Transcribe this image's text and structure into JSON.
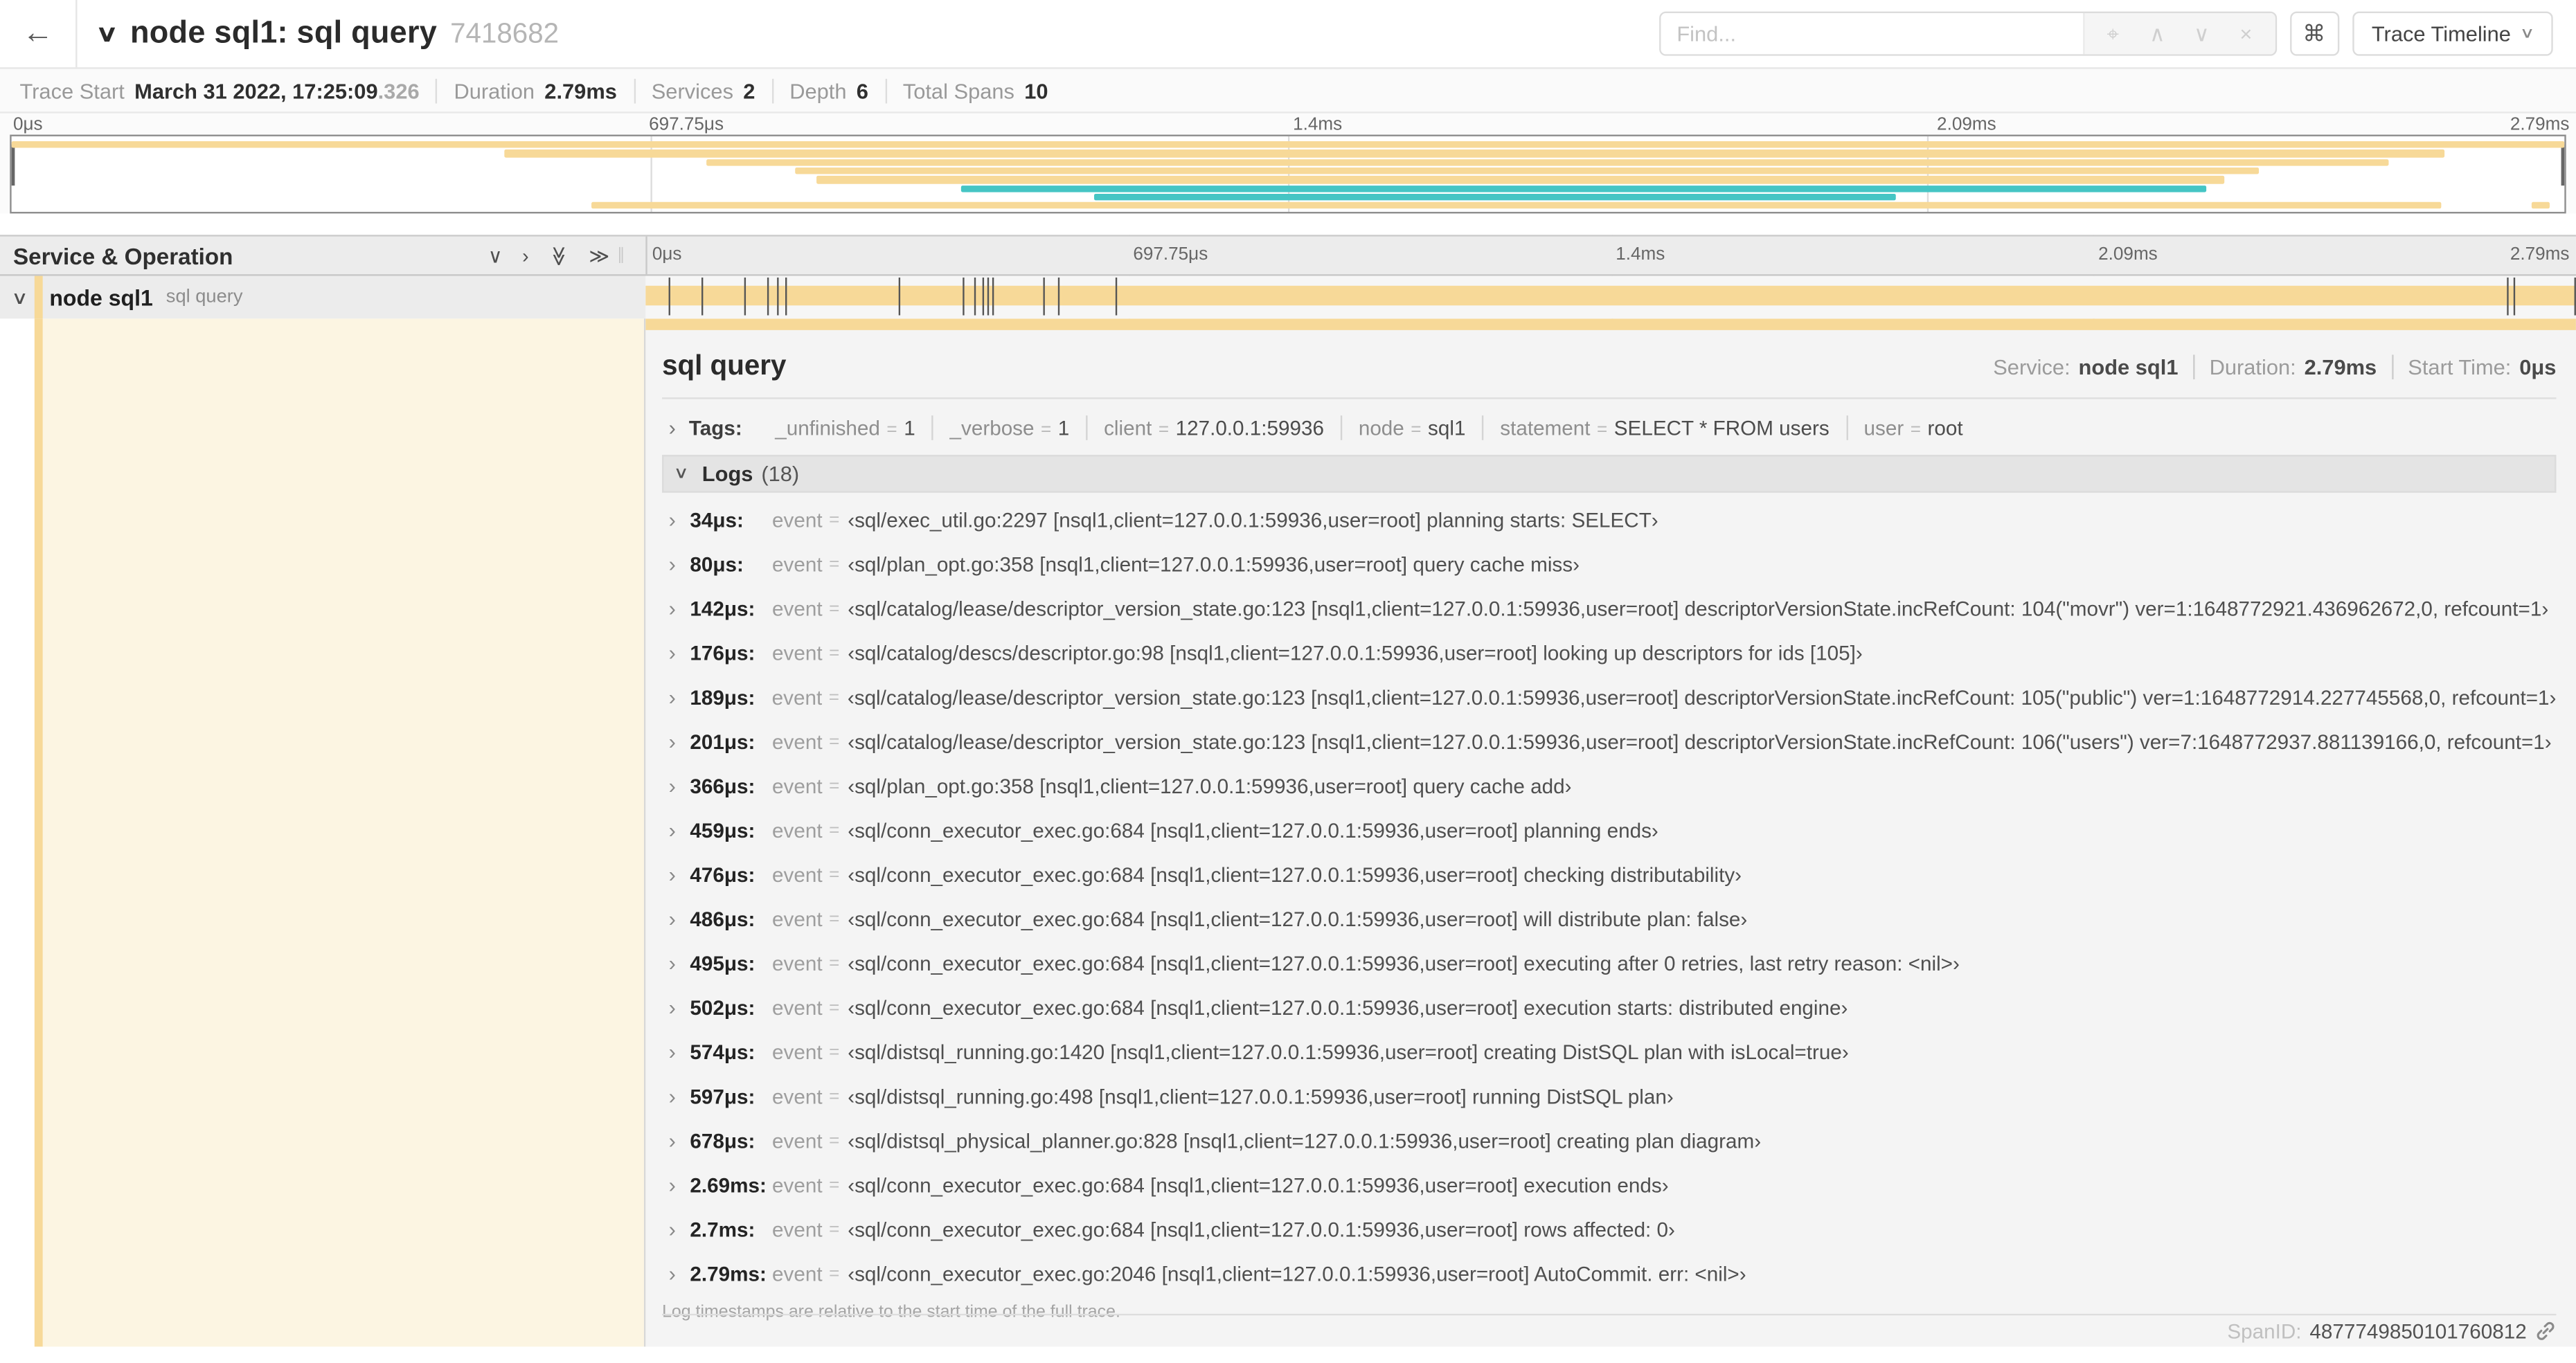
{
  "icons": {
    "back": "←",
    "collapse": "∨",
    "chevron_right": "›",
    "chevron_down": "∨",
    "double_chevron_right": "≫",
    "crosshair": "⌖",
    "up": "∧",
    "down": "∨",
    "close": "×",
    "grip": "∥",
    "command": "⌘",
    "caret": "∨"
  },
  "header": {
    "title": "node sql1: sql query",
    "trace_id_short": "7418682",
    "find_placeholder": "Find...",
    "view_selector": "Trace Timeline"
  },
  "summary": {
    "items": [
      {
        "label": "Trace Start",
        "value": "March 31 2022, 17:25:09",
        "suffix": ".326"
      },
      {
        "label": "Duration",
        "value": "2.79ms"
      },
      {
        "label": "Services",
        "value": "2"
      },
      {
        "label": "Depth",
        "value": "6"
      },
      {
        "label": "Total Spans",
        "value": "10"
      }
    ]
  },
  "axis": {
    "labels": [
      "0μs",
      "697.75μs",
      "1.4ms",
      "2.09ms",
      "2.79ms"
    ],
    "positions_pct": [
      0,
      25,
      50,
      75,
      100
    ]
  },
  "minimap": {
    "colors": {
      "tan": "#f7d998",
      "teal": "#45c5c4"
    },
    "spans": [
      {
        "row": 0,
        "left": 0,
        "width": 100,
        "color": "tan"
      },
      {
        "row": 1,
        "left": 19.3,
        "width": 76.0,
        "color": "tan"
      },
      {
        "row": 2,
        "left": 27.2,
        "width": 65.9,
        "color": "tan"
      },
      {
        "row": 3,
        "left": 30.7,
        "width": 57.3,
        "color": "tan"
      },
      {
        "row": 4,
        "left": 31.5,
        "width": 55.2,
        "color": "tan"
      },
      {
        "row": 5,
        "left": 37.2,
        "width": 48.8,
        "color": "teal"
      },
      {
        "row": 6,
        "left": 42.4,
        "width": 31.4,
        "color": "teal"
      },
      {
        "row": 7,
        "left": 22.7,
        "width": 72.5,
        "color": "tan"
      },
      {
        "row": 7,
        "left": 98.7,
        "width": 0.7,
        "color": "tan"
      }
    ]
  },
  "timeline_header": {
    "title": "Service & Operation"
  },
  "span_row": {
    "service": "node sql1",
    "operation": "sql query",
    "tick_positions_pct": [
      1.22,
      2.87,
      5.09,
      6.31,
      6.77,
      7.2,
      13.12,
      16.45,
      17.06,
      17.42,
      17.74,
      17.99,
      20.57,
      21.4,
      24.3,
      96.42,
      96.77,
      99.9
    ]
  },
  "detail": {
    "title": "sql query",
    "meta": [
      {
        "label": "Service:",
        "value": "node sql1"
      },
      {
        "label": "Duration:",
        "value": "2.79ms"
      },
      {
        "label": "Start Time:",
        "value": "0μs"
      }
    ],
    "tags_label": "Tags:",
    "tags": [
      {
        "key": "_unfinished",
        "value": "1"
      },
      {
        "key": "_verbose",
        "value": "1"
      },
      {
        "key": "client",
        "value": "127.0.0.1:59936"
      },
      {
        "key": "node",
        "value": "sql1"
      },
      {
        "key": "statement",
        "value": "SELECT * FROM users"
      },
      {
        "key": "user",
        "value": "root"
      }
    ],
    "logs_label": "Logs",
    "logs_count": "(18)",
    "logs": [
      {
        "ts": "34μs:",
        "field": "event",
        "value": "‹sql/exec_util.go:2297 [nsql1,client=127.0.0.1:59936,user=root] planning starts: SELECT›"
      },
      {
        "ts": "80μs:",
        "field": "event",
        "value": "‹sql/plan_opt.go:358 [nsql1,client=127.0.0.1:59936,user=root] query cache miss›"
      },
      {
        "ts": "142μs:",
        "field": "event",
        "value": "‹sql/catalog/lease/descriptor_version_state.go:123 [nsql1,client=127.0.0.1:59936,user=root] descriptorVersionState.incRefCount: 104(\"movr\") ver=1:1648772921.436962672,0, refcount=1›"
      },
      {
        "ts": "176μs:",
        "field": "event",
        "value": "‹sql/catalog/descs/descriptor.go:98 [nsql1,client=127.0.0.1:59936,user=root] looking up descriptors for ids [105]›"
      },
      {
        "ts": "189μs:",
        "field": "event",
        "value": "‹sql/catalog/lease/descriptor_version_state.go:123 [nsql1,client=127.0.0.1:59936,user=root] descriptorVersionState.incRefCount: 105(\"public\") ver=1:1648772914.227745568,0, refcount=1›"
      },
      {
        "ts": "201μs:",
        "field": "event",
        "value": "‹sql/catalog/lease/descriptor_version_state.go:123 [nsql1,client=127.0.0.1:59936,user=root] descriptorVersionState.incRefCount: 106(\"users\") ver=7:1648772937.881139166,0, refcount=1›"
      },
      {
        "ts": "366μs:",
        "field": "event",
        "value": "‹sql/plan_opt.go:358 [nsql1,client=127.0.0.1:59936,user=root] query cache add›"
      },
      {
        "ts": "459μs:",
        "field": "event",
        "value": "‹sql/conn_executor_exec.go:684 [nsql1,client=127.0.0.1:59936,user=root] planning ends›"
      },
      {
        "ts": "476μs:",
        "field": "event",
        "value": "‹sql/conn_executor_exec.go:684 [nsql1,client=127.0.0.1:59936,user=root] checking distributability›"
      },
      {
        "ts": "486μs:",
        "field": "event",
        "value": "‹sql/conn_executor_exec.go:684 [nsql1,client=127.0.0.1:59936,user=root] will distribute plan: false›"
      },
      {
        "ts": "495μs:",
        "field": "event",
        "value": "‹sql/conn_executor_exec.go:684 [nsql1,client=127.0.0.1:59936,user=root] executing after 0 retries, last retry reason: <nil>›"
      },
      {
        "ts": "502μs:",
        "field": "event",
        "value": "‹sql/conn_executor_exec.go:684 [nsql1,client=127.0.0.1:59936,user=root] execution starts: distributed engine›"
      },
      {
        "ts": "574μs:",
        "field": "event",
        "value": "‹sql/distsql_running.go:1420 [nsql1,client=127.0.0.1:59936,user=root] creating DistSQL plan with isLocal=true›"
      },
      {
        "ts": "597μs:",
        "field": "event",
        "value": "‹sql/distsql_running.go:498 [nsql1,client=127.0.0.1:59936,user=root] running DistSQL plan›"
      },
      {
        "ts": "678μs:",
        "field": "event",
        "value": "‹sql/distsql_physical_planner.go:828 [nsql1,client=127.0.0.1:59936,user=root] creating plan diagram›"
      },
      {
        "ts": "2.69ms:",
        "field": "event",
        "value": "‹sql/conn_executor_exec.go:684 [nsql1,client=127.0.0.1:59936,user=root] execution ends›"
      },
      {
        "ts": "2.7ms:",
        "field": "event",
        "value": "‹sql/conn_executor_exec.go:684 [nsql1,client=127.0.0.1:59936,user=root] rows affected: 0›"
      },
      {
        "ts": "2.79ms:",
        "field": "event",
        "value": "‹sql/conn_executor_exec.go:2046 [nsql1,client=127.0.0.1:59936,user=root] AutoCommit. err: <nil>›"
      }
    ],
    "footnote": "Log timestamps are relative to the start time of the full trace.",
    "span_id_label": "SpanID:",
    "span_id": "4877749850101760812"
  }
}
